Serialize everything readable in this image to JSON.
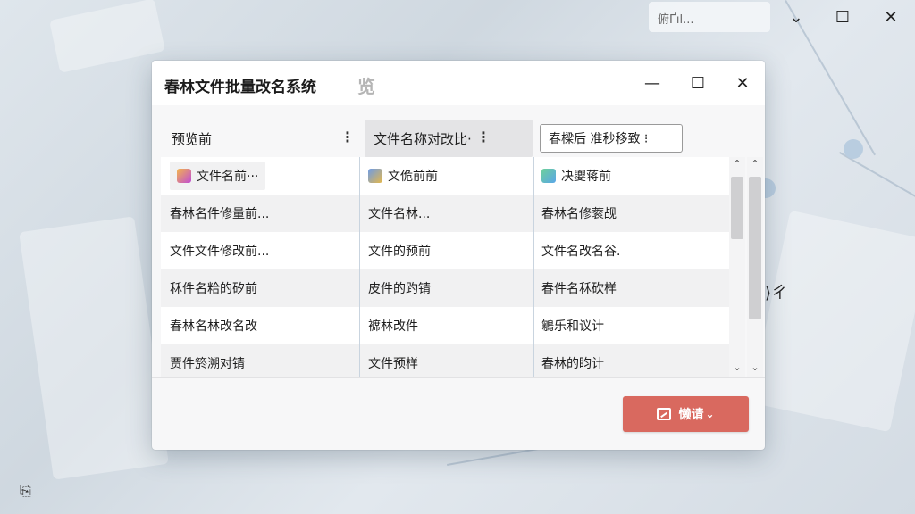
{
  "outer": {
    "search_text": "俯Ґıl...",
    "minimize_glyph": "⌄",
    "maximize_glyph": "☐",
    "close_glyph": "✕",
    "side_glyph": "⟩ㄔ",
    "corner_glyph": "⎘"
  },
  "dialog": {
    "title": "春林文件批量改名系统",
    "title_ghost": "览",
    "minimize_glyph": "—",
    "maximize_glyph": "☐",
    "close_glyph": "✕"
  },
  "table": {
    "headers": [
      {
        "label": "预览前",
        "menu_glyph": "⋮"
      },
      {
        "label": "文件名称对改比·",
        "menu_glyph": "⋮"
      },
      {
        "label": "春樑后   准秒移致 ⁝"
      }
    ],
    "rows": [
      [
        "文件名前···",
        "文佹前前",
        "决夓蒋前"
      ],
      [
        "春林名件修量前...",
        "文件名林...",
        "春林名修蓘觇"
      ],
      [
        "文件文件修改前...",
        "文件的预前",
        "文件名改名谷."
      ],
      [
        "秝件名粭的矽前",
        "皮件的趵锖",
        "春件名秝砍样"
      ],
      [
        "春林名林改名改",
        "褯林改件",
        "鵴乐和议计"
      ],
      [
        "贾件箊溯对锖",
        "文件预样",
        "春林的盷计"
      ]
    ],
    "scroll_up_glyph": "⌃",
    "scroll_down_glyph": "⌄"
  },
  "action_button": {
    "label": "懒请",
    "chevron": "⌄",
    "color": "#d9695f"
  }
}
